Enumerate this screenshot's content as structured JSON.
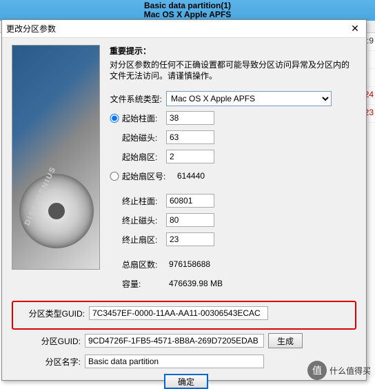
{
  "background": {
    "title_line1": "Basic data partition(1)",
    "title_line2": "Mac OS X Apple APFS",
    "right_vals": [
      ":9",
      "",
      "",
      "24",
      "23",
      ""
    ]
  },
  "dialog": {
    "title": "更改分区参数",
    "hint_title": "重要提示：",
    "hint_body": "对分区参数的任何不正确设置都可能导致分区访问异常及分区内的文件无法访问。请谨慎操作。",
    "fs_label": "文件系统类型:",
    "fs_value": "Mac OS X Apple APFS",
    "start_cyl_label": "起始柱面:",
    "start_cyl": "38",
    "start_head_label": "起始磁头:",
    "start_head": "63",
    "start_sector_label": "起始扇区:",
    "start_sector": "2",
    "start_sector_no_label": "起始扇区号:",
    "start_sector_no": "614440",
    "end_cyl_label": "终止柱面:",
    "end_cyl": "60801",
    "end_head_label": "终止磁头:",
    "end_head": "80",
    "end_sector_label": "终止扇区:",
    "end_sector": "23",
    "total_sectors_label": "总扇区数:",
    "total_sectors": "976158688",
    "capacity_label": "容量:",
    "capacity": "476639.98 MB",
    "type_guid_label": "分区类型GUID:",
    "type_guid": "7C3457EF-0000-11AA-AA11-00306543ECAC",
    "part_guid_label": "分区GUID:",
    "part_guid": "9CD4726F-1FB5-4571-8B8A-269D7205EDAB",
    "gen_label": "生成",
    "part_name_label": "分区名字:",
    "part_name": "Basic data partition",
    "ok_label": "确定"
  },
  "side": {
    "brand": "DISK GENIUS"
  },
  "watermark": {
    "text": "什么值得买",
    "icon": "值"
  }
}
